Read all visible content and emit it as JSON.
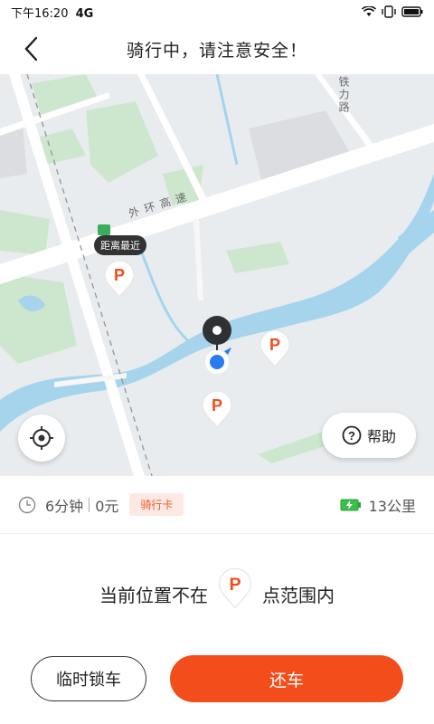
{
  "status_bar": {
    "time": "下午16:20",
    "network": "4G"
  },
  "header": {
    "title": "骑行中，请注意安全！"
  },
  "map": {
    "road_label_vertical": "铁力路",
    "road_label_highway": "外环高速",
    "nearest_tag": "距离最近",
    "help_label": "帮助",
    "parking_letter": "P"
  },
  "ride_info": {
    "duration": "6分钟",
    "cost": "0元",
    "card_badge": "骑行卡",
    "remaining_range": "13公里"
  },
  "notice": {
    "before": "当前位置不在",
    "after": "点范围内"
  },
  "actions": {
    "lock_label": "临时锁车",
    "return_label": "还车"
  },
  "colors": {
    "accent": "#F24D1B",
    "water": "#A6D4EC",
    "green": "#CDE7CF"
  }
}
